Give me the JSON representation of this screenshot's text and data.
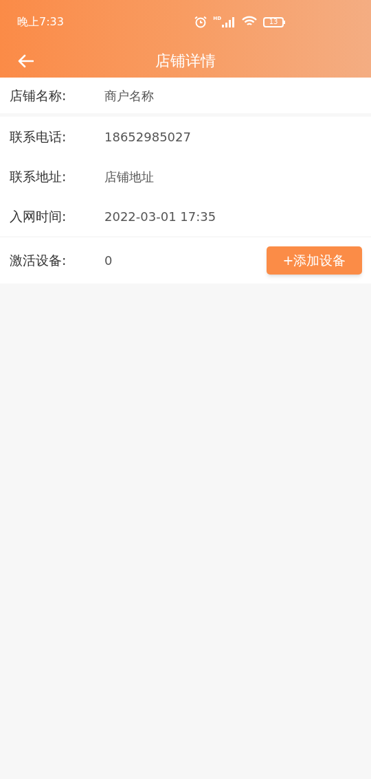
{
  "status_bar": {
    "time": "晚上7:33",
    "network_label": "HD",
    "battery": "13"
  },
  "header": {
    "title": "店铺详情"
  },
  "rows": [
    {
      "label": "店铺名称:",
      "value": "商户名称"
    },
    {
      "label": "联系电话:",
      "value": "18652985027"
    },
    {
      "label": "联系地址:",
      "value": "店铺地址"
    },
    {
      "label": "入网时间:",
      "value": "2022-03-01 17:35"
    },
    {
      "label": "激活设备:",
      "value": "0",
      "button": "+添加设备"
    }
  ]
}
